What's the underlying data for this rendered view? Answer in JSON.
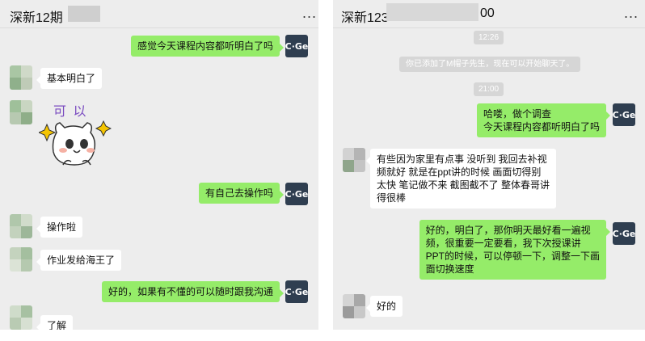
{
  "left": {
    "title": "深新12期",
    "more_label": "...",
    "me_avatar_text": "C·Ge",
    "messages": {
      "m1": "感觉今天课程内容都听明白了吗",
      "m2": "基本明白了",
      "sticker_text": "可 以",
      "m3": "有自己去操作吗",
      "m4": "操作啦",
      "m5": "作业发给海王了",
      "m6": "好的，如果有不懂的可以随时跟我沟通",
      "m7": "了解"
    }
  },
  "right": {
    "title_start": "深新123",
    "title_end": "00",
    "more_label": "...",
    "me_avatar_text": "C·Ge",
    "time1": "12:26",
    "system_notice": "你已添加了M帽子先生，现在可以开始聊天了。",
    "time2": "21:00",
    "messages": {
      "r1": "哈喽，做个调查\n今天课程内容都听明白了吗",
      "r2": "有些因为家里有点事 没听到 我回去补视\n频就好 就是在ppt讲的时候 画面切得别\n太快 笔记做不来 截图截不了 整体春哥讲\n得很棒",
      "r3": "好的，明白了，那你明天最好看一遍视\n频，很重要一定要看，我下次授课讲\nPPT的时候，可以停顿一下，调整一下画\n面切换速度",
      "r4": "好的"
    }
  },
  "colors": {
    "outgoing_bubble": "#95ec69",
    "incoming_bubble": "#ffffff",
    "background": "#ededed",
    "me_avatar": "#2f3e50"
  }
}
